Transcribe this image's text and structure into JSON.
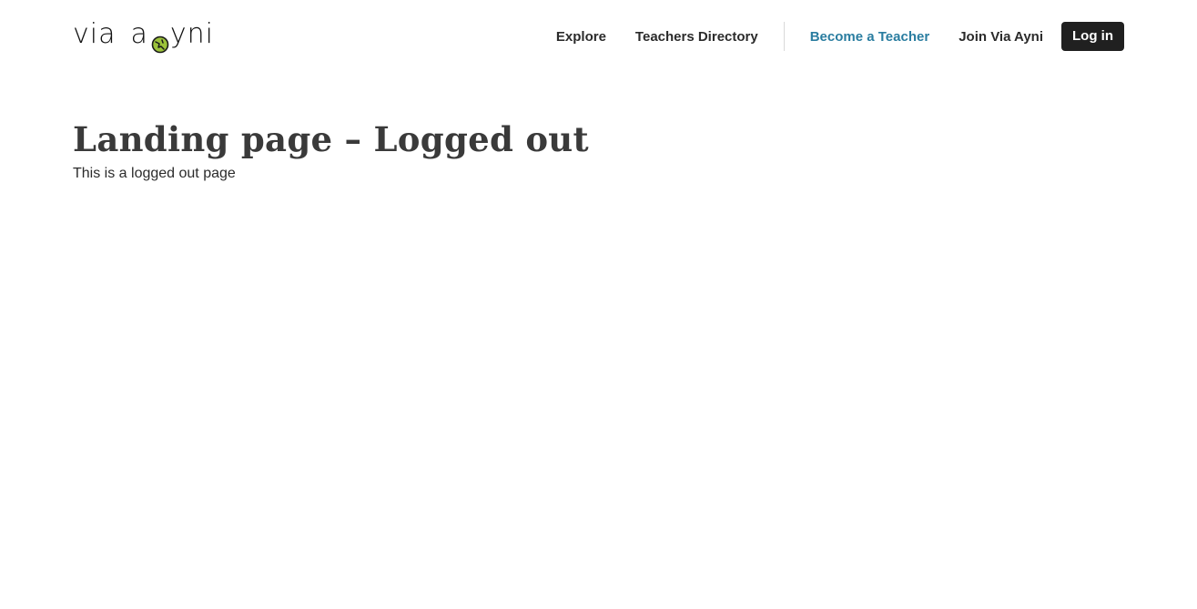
{
  "header": {
    "logo": {
      "part1": "via",
      "part2": "a",
      "part3": "yni",
      "globe_icon": "globe-icon",
      "globe_colors": {
        "fill": "#9cc23a",
        "stroke": "#1a1a1a"
      }
    },
    "nav": {
      "explore": "Explore",
      "teachers_directory": "Teachers Directory",
      "become_teacher": "Become a Teacher",
      "join": "Join Via Ayni",
      "login": "Log in"
    },
    "colors": {
      "become_teacher": "#2a7da0",
      "login_bg": "#202020"
    }
  },
  "main": {
    "title": "Landing page – Logged out",
    "text": "This is a logged out page"
  }
}
